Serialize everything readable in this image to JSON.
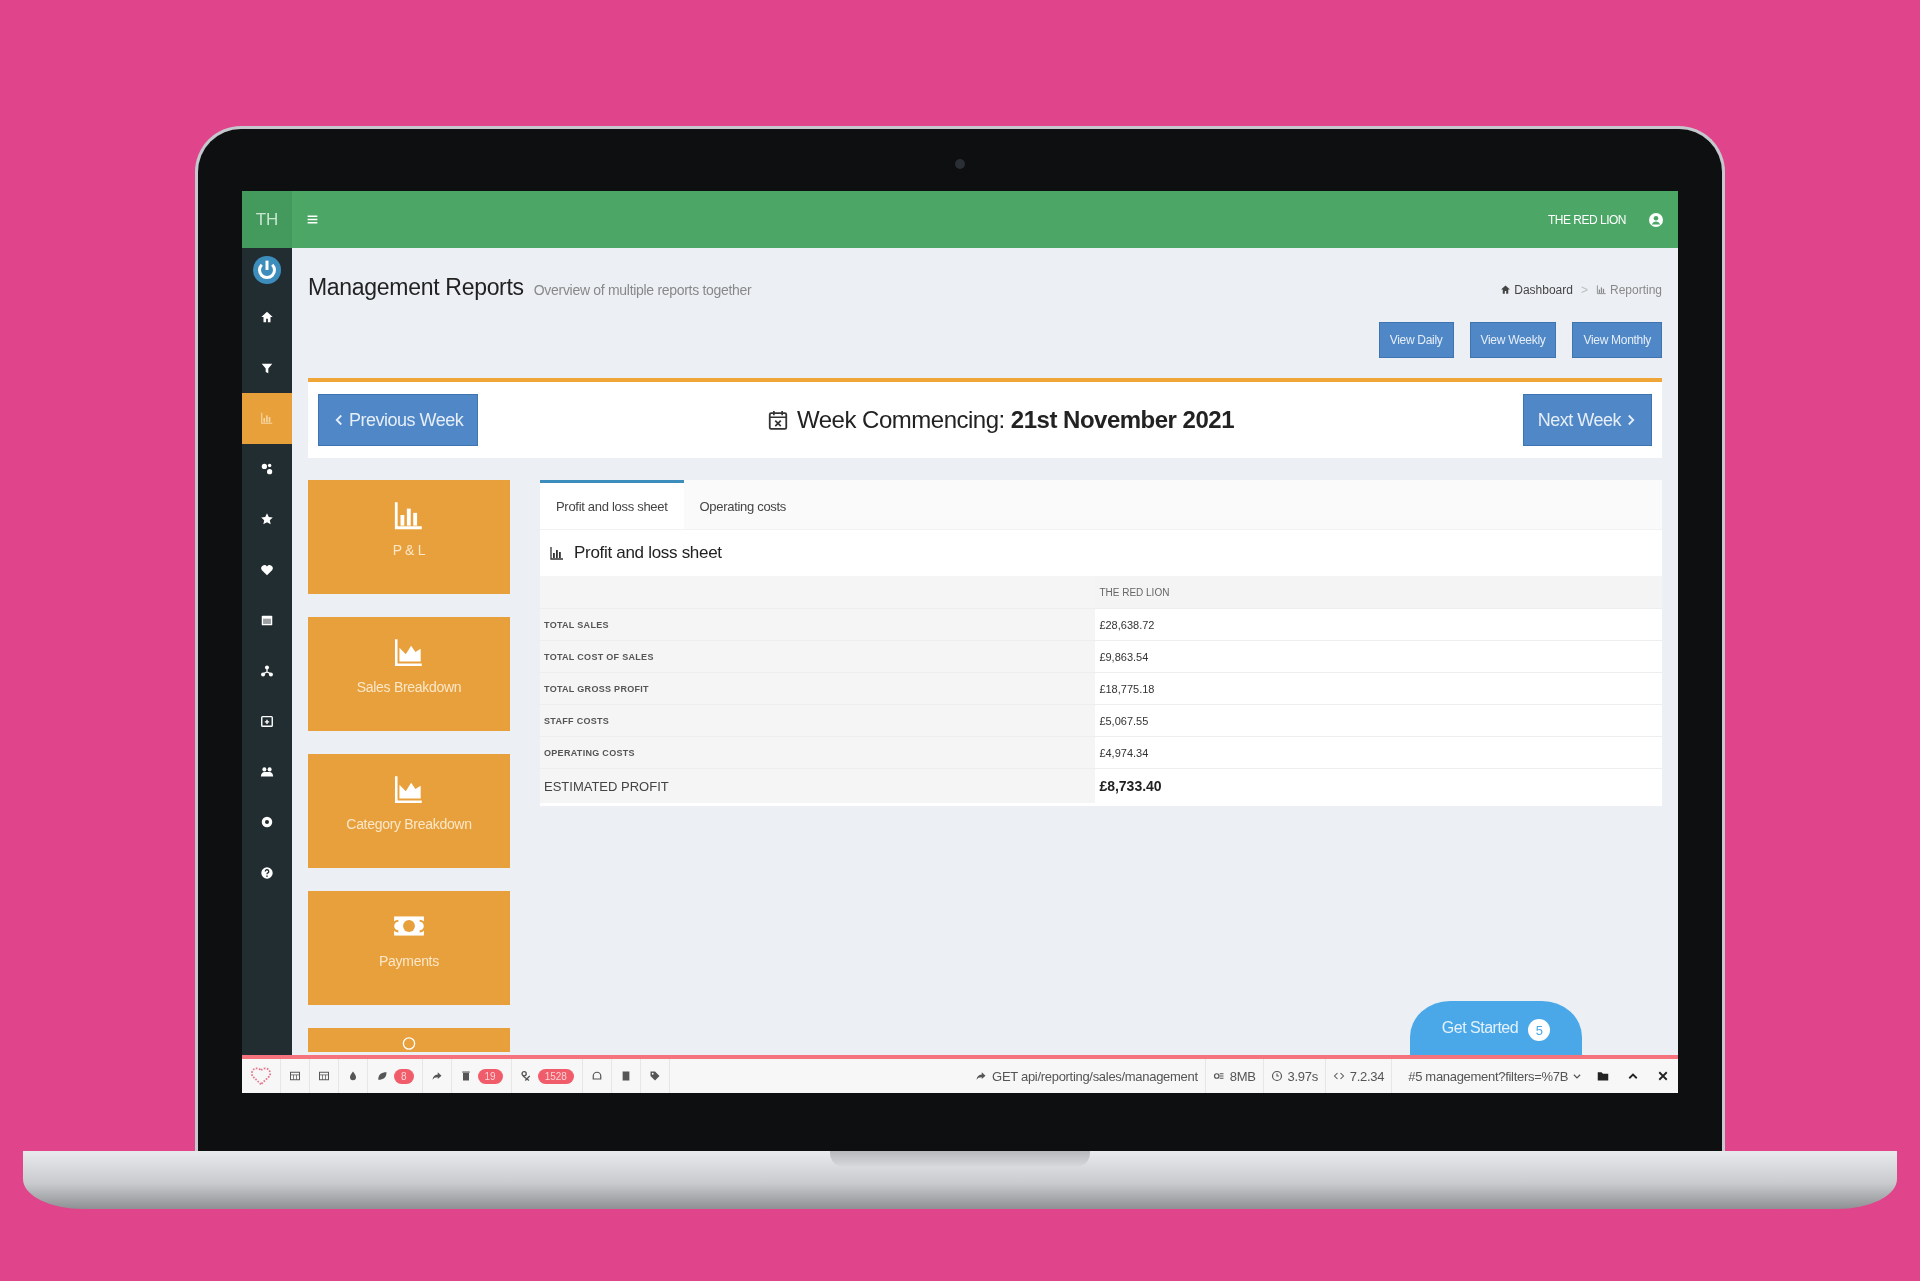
{
  "topbar": {
    "brand": "TH",
    "account": "THE RED LION"
  },
  "sidebar": {
    "items": [
      {
        "selected": false
      },
      {
        "selected": false
      },
      {
        "selected": false
      },
      {
        "selected": true
      },
      {
        "selected": false
      },
      {
        "selected": false
      },
      {
        "selected": false
      },
      {
        "selected": false
      },
      {
        "selected": false
      },
      {
        "selected": false
      },
      {
        "selected": false
      },
      {
        "selected": false
      },
      {
        "selected": false
      }
    ]
  },
  "header": {
    "title": "Management Reports",
    "subtitle": "Overview of multiple reports together",
    "breadcrumbs": [
      "Dashboard",
      "Reporting"
    ],
    "breadcrumb_separator": ">"
  },
  "view_buttons": [
    "View Daily",
    "View Weekly",
    "View Monthly"
  ],
  "week": {
    "previous": "Previous Week",
    "label": "Week Commencing:",
    "date": "21st November 2021",
    "next": "Next Week"
  },
  "report_cards": [
    {
      "kind": "bars",
      "label": "P & L"
    },
    {
      "kind": "area",
      "label": "Sales Breakdown"
    },
    {
      "kind": "area",
      "label": "Category Breakdown"
    },
    {
      "kind": "money",
      "label": "Payments"
    },
    {
      "kind": "circle"
    }
  ],
  "tabs": [
    {
      "label": "Profit and loss sheet",
      "selected": true
    },
    {
      "label": "Operating costs",
      "selected": false
    }
  ],
  "panel_title": "Profit and loss sheet",
  "table": {
    "columns": [
      "THE RED LION"
    ],
    "rows": [
      {
        "kind": "item",
        "label": "TOTAL SALES",
        "value": "£28,638.72"
      },
      {
        "kind": "item",
        "label": "TOTAL COST OF SALES",
        "value": "£9,863.54"
      },
      {
        "kind": "item",
        "label": "TOTAL GROSS PROFIT",
        "value": "£18,775.18"
      },
      {
        "kind": "item",
        "label": "STAFF COSTS",
        "value": "£5,067.55"
      },
      {
        "kind": "item",
        "label": "OPERATING COSTS",
        "value": "£4,974.34"
      },
      {
        "kind": "total",
        "label": "ESTIMATED PROFIT",
        "value": "£8,733.40"
      }
    ]
  },
  "get_started": {
    "label": "Get Started",
    "count": "5"
  },
  "debug_bar": {
    "badges": [
      "8",
      "19",
      "1528"
    ],
    "request": "GET api/reporting/sales/management",
    "memory": "8MB",
    "time": "3.97s",
    "version": "7.2.34",
    "request_select": "#5 management?filters=%7B"
  }
}
